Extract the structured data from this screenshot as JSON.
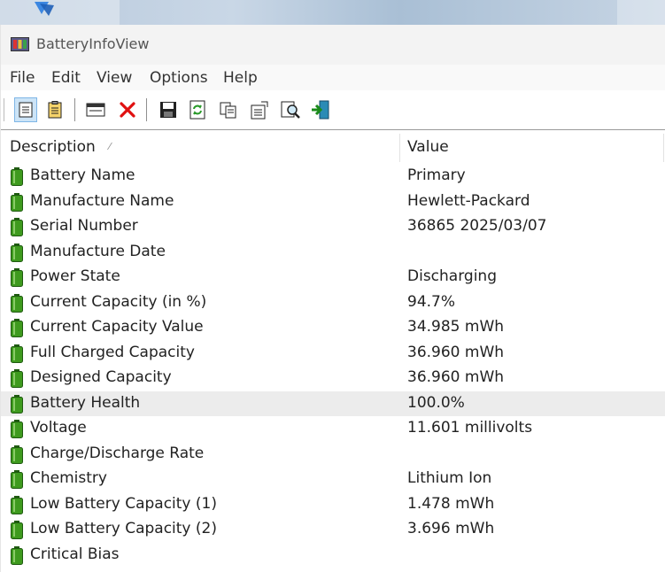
{
  "window": {
    "title": "BatteryInfoView"
  },
  "menu": [
    "File",
    "Edit",
    "View",
    "Options",
    "Help"
  ],
  "toolbar": {
    "buttons": [
      {
        "name": "html-report-icon"
      },
      {
        "name": "properties-list-icon"
      },
      {
        "name": "window-icon"
      },
      {
        "name": "delete-icon"
      },
      {
        "name": "save-icon"
      },
      {
        "name": "refresh-icon"
      },
      {
        "name": "copy-icon"
      },
      {
        "name": "properties-icon"
      },
      {
        "name": "find-icon"
      },
      {
        "name": "exit-icon"
      }
    ]
  },
  "columns": {
    "description": "Description",
    "value": "Value"
  },
  "rows": [
    {
      "description": "Battery Name",
      "value": "Primary"
    },
    {
      "description": "Manufacture Name",
      "value": "Hewlett-Packard"
    },
    {
      "description": "Serial Number",
      "value": "36865 2025/03/07"
    },
    {
      "description": "Manufacture Date",
      "value": ""
    },
    {
      "description": "Power State",
      "value": "Discharging"
    },
    {
      "description": "Current Capacity (in %)",
      "value": "94.7%"
    },
    {
      "description": "Current Capacity Value",
      "value": "34.985 mWh"
    },
    {
      "description": "Full Charged Capacity",
      "value": "36.960 mWh"
    },
    {
      "description": "Designed Capacity",
      "value": "36.960 mWh"
    },
    {
      "description": "Battery Health",
      "value": "100.0%"
    },
    {
      "description": "Voltage",
      "value": "11.601 millivolts"
    },
    {
      "description": "Charge/Discharge Rate",
      "value": ""
    },
    {
      "description": "Chemistry",
      "value": "Lithium Ion"
    },
    {
      "description": "Low Battery Capacity (1)",
      "value": "1.478 mWh"
    },
    {
      "description": "Low Battery Capacity (2)",
      "value": "3.696 mWh"
    },
    {
      "description": "Critical Bias",
      "value": ""
    }
  ],
  "selected_row": "Battery Health",
  "colors": {
    "battery_green": "#3e9a1e",
    "selected_row": "#ececec"
  }
}
